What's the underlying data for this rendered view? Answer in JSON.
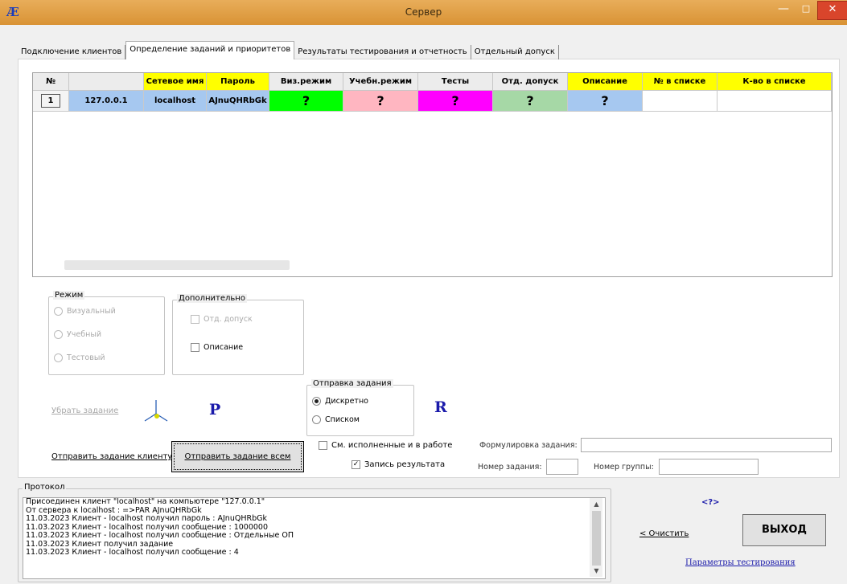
{
  "window": {
    "title": "Сервер",
    "icon": "app-logo-icon",
    "minimize_glyph": "—",
    "maximize_glyph": "□",
    "close_glyph": "✕"
  },
  "tabs": [
    {
      "label": "Подключение клиентов",
      "active": false
    },
    {
      "label": "Определение заданий и приоритетов",
      "active": true
    },
    {
      "label": "Результаты тестирования и отчетность",
      "active": false
    },
    {
      "label": "Отдельный допуск",
      "active": false
    }
  ],
  "grid": {
    "columns": [
      "№",
      "",
      "Сетевое имя",
      "Пароль",
      "Виз.режим",
      "Учебн.режим",
      "Тесты",
      "Отд. допуск",
      "Описание",
      "№ в списке",
      "К-во в списке"
    ],
    "rows": [
      {
        "num": "1",
        "ip": "127.0.0.1",
        "name": "localhost",
        "password": "AJnuQHRbGk",
        "viz": "?",
        "ucheb": "?",
        "tests": "?",
        "otd": "?",
        "opis": "?",
        "num_in_list": "",
        "count_in_list": ""
      }
    ]
  },
  "colors": {
    "viz": "#00ff00",
    "ucheb": "#ffb6c1",
    "tests": "#ff00ff",
    "otd": "#a6d8a6",
    "opis": "#a6c8f0",
    "header_yellow": "#ffff00",
    "title_bar": "#e0a048",
    "close_button": "#d9452b"
  },
  "mode_group": {
    "legend": "Режим",
    "options": [
      "Визуальный",
      "Учебный",
      "Тестовый"
    ]
  },
  "extra_group": {
    "legend": "Дополнительно",
    "options": [
      "Отд. допуск",
      "Описание"
    ]
  },
  "send_group": {
    "legend": "Отправка задания",
    "options": [
      "Дискретно",
      "Списком"
    ],
    "selected": "Дискретно"
  },
  "actions": {
    "remove_task": "Убрать задание",
    "send_to_client": "Отправить задание клиенту",
    "send_to_all": "Отправить задание всем",
    "letter_p": "P",
    "letter_r": "R"
  },
  "checkboxes": {
    "show_done": "См. исполненные и в работе",
    "record_result": "Запись результата"
  },
  "fields": {
    "task_formulation_label": "Формулировка задания:",
    "task_number_label": "Номер задания:",
    "group_number_label": "Номер группы:",
    "task_formulation_value": "",
    "task_number_value": "",
    "group_number_value": ""
  },
  "protocol": {
    "legend": "Протокол",
    "lines": [
      "Присоединен клиент \"localhost\" на компьютере \"127.0.0.1\"",
      "От сервера к localhost : =>PAR AJnuQHRbGk",
      "11.03.2023 Клиент - localhost получил пароль : AJnuQHRbGk",
      "11.03.2023 Клиент - localhost получил сообщение : 1000000",
      "11.03.2023 Клиент - localhost получил сообщение : Отдельные ОП",
      "11.03.2023 Клиент получил задание",
      "11.03.2023 Клиент - localhost получил сообщение : 4"
    ]
  },
  "bottom_right": {
    "help": "<?>",
    "clear": "< Очистить",
    "exit": "ВЫХОД",
    "params": "Параметры тестирования"
  }
}
